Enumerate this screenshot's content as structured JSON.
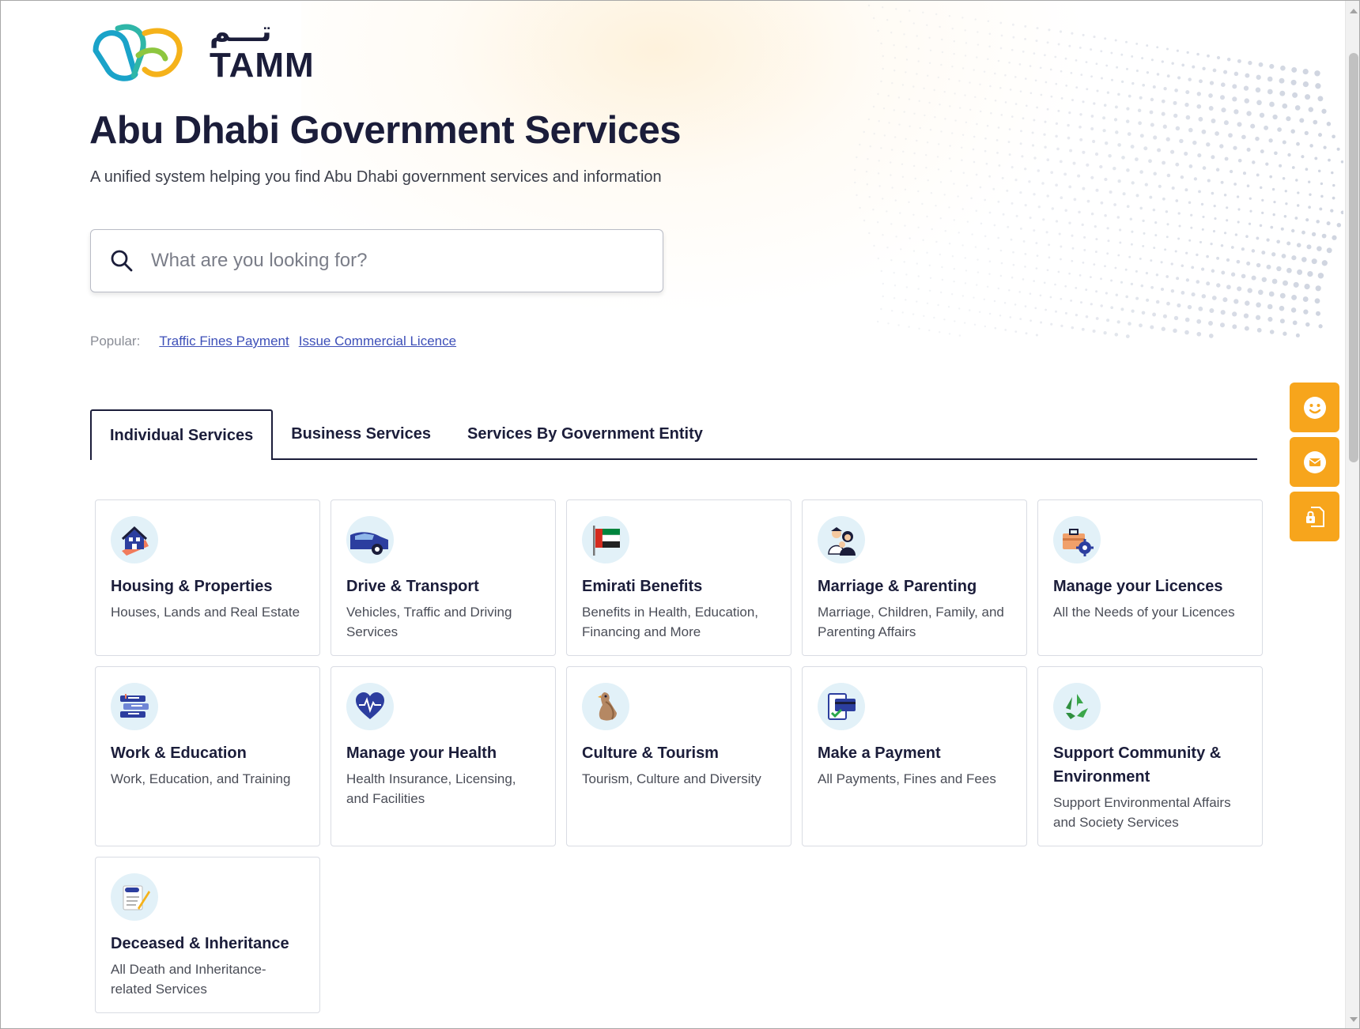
{
  "brand": {
    "name_en": "TAMM",
    "name_ar": "تـــم"
  },
  "hero": {
    "title": "Abu Dhabi Government Services",
    "subtitle": "A unified system helping you find Abu Dhabi government services and information"
  },
  "search": {
    "placeholder": "What are you looking for?",
    "value": ""
  },
  "popular": {
    "label": "Popular:",
    "links": [
      "Traffic Fines Payment",
      "Issue Commercial Licence"
    ]
  },
  "tabs": [
    {
      "label": "Individual Services",
      "active": true
    },
    {
      "label": "Business Services",
      "active": false
    },
    {
      "label": "Services By Government Entity",
      "active": false
    }
  ],
  "cards": [
    {
      "icon": "house-icon",
      "title": "Housing & Properties",
      "desc": "Houses, Lands and Real Estate"
    },
    {
      "icon": "car-icon",
      "title": "Drive & Transport",
      "desc": "Vehicles, Traffic and Driving Services"
    },
    {
      "icon": "uae-flag-icon",
      "title": "Emirati Benefits",
      "desc": "Benefits in Health, Education, Financing and More"
    },
    {
      "icon": "family-icon",
      "title": "Marriage & Parenting",
      "desc": "Marriage, Children, Family, and Parenting Affairs"
    },
    {
      "icon": "briefcase-gear-icon",
      "title": "Manage your Licences",
      "desc": "All the Needs of your Licences"
    },
    {
      "icon": "books-icon",
      "title": "Work & Education",
      "desc": "Work, Education, and Training"
    },
    {
      "icon": "heart-pulse-icon",
      "title": "Manage your Health",
      "desc": "Health Insurance, Licensing, and Facilities"
    },
    {
      "icon": "falcon-icon",
      "title": "Culture & Tourism",
      "desc": "Tourism, Culture and Diversity"
    },
    {
      "icon": "payment-card-icon",
      "title": "Make a Payment",
      "desc": "All Payments, Fines and Fees"
    },
    {
      "icon": "recycle-icon",
      "title": "Support Community & Environment",
      "desc": "Support Environmental Affairs and Society Services"
    },
    {
      "icon": "document-pen-icon",
      "title": "Deceased & Inheritance",
      "desc": "All Death and Inheritance-related Services"
    }
  ],
  "side_buttons": [
    {
      "icon": "smiley-icon"
    },
    {
      "icon": "mail-icon"
    },
    {
      "icon": "locked-document-icon"
    }
  ],
  "colors": {
    "brand_dark": "#1b1d3a",
    "accent_orange": "#f7a51c",
    "link_blue": "#3d4fb8",
    "icon_bg": "#e2f1f8"
  }
}
